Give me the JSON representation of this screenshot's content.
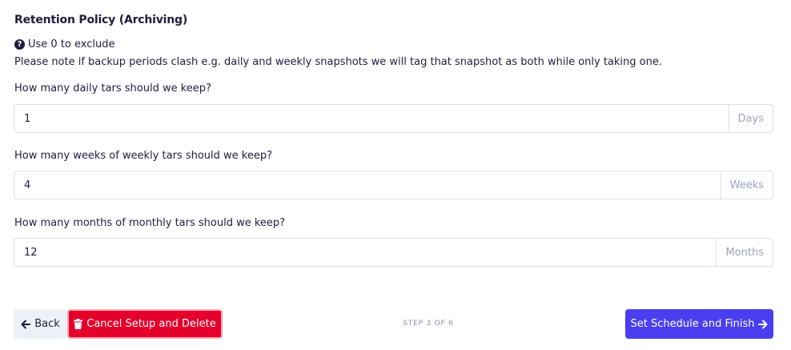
{
  "section": {
    "title": "Retention Policy (Archiving)",
    "hint_text": "Use 0 to exclude",
    "note": "Please note if backup periods clash e.g. daily and weekly snapshots we will tag that snapshot as both while only taking one."
  },
  "fields": [
    {
      "label": "How many daily tars should we keep?",
      "value": "1",
      "unit": "Days"
    },
    {
      "label": "How many weeks of weekly tars should we keep?",
      "value": "4",
      "unit": "Weeks"
    },
    {
      "label": "How many months of monthly tars should we keep?",
      "value": "12",
      "unit": "Months"
    }
  ],
  "footer": {
    "back_label": "Back",
    "cancel_label": "Cancel Setup and Delete",
    "step_text": "STEP 3 OF 6",
    "finish_label": "Set Schedule and Finish"
  },
  "colors": {
    "primary": "#4b3ef0",
    "danger": "#e4002b",
    "text": "#1f1d3d"
  },
  "icons": {
    "hint": "question-circle-icon",
    "back": "arrow-left-icon",
    "cancel": "trash-icon",
    "finish": "arrow-right-icon"
  }
}
